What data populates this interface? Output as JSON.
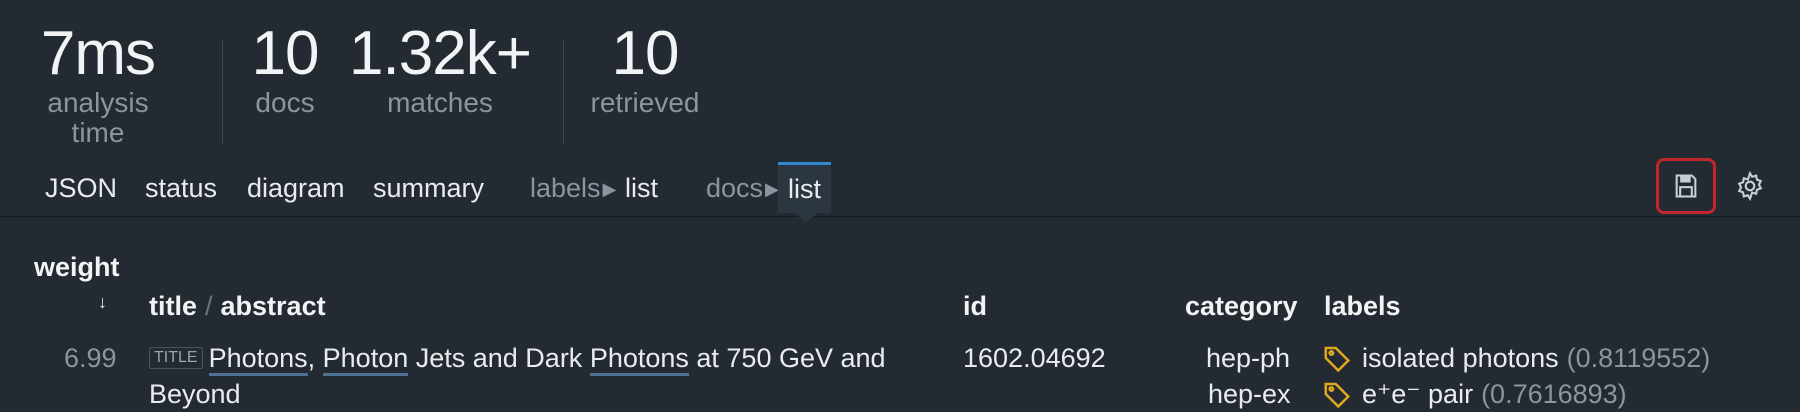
{
  "stats": [
    {
      "value": "7ms",
      "label": "analysis time"
    },
    {
      "value": "10",
      "label": "docs"
    },
    {
      "value": "1.32k+",
      "label": "matches"
    },
    {
      "value": "10",
      "label": "retrieved"
    }
  ],
  "tabs": {
    "json": "JSON",
    "status": "status",
    "diagram": "diagram",
    "summary": "summary",
    "labels_group": "labels",
    "labels_list": "list",
    "docs_group": "docs",
    "docs_list": "list"
  },
  "toolbar": {
    "save_icon": "save-icon",
    "settings_icon": "gear-icon"
  },
  "table": {
    "headers": {
      "weight": "weight",
      "title": "title",
      "abstract": "abstract",
      "id": "id",
      "category": "category",
      "labels": "labels"
    },
    "rows": [
      {
        "weight": "6.99",
        "title_tag": "TITLE",
        "title_parts": [
          "Photons",
          ", ",
          "Photon",
          " Jets and Dark ",
          "Photons",
          " at 750 GeV and"
        ],
        "title_line2": "Beyond",
        "id": "1602.04692",
        "categories": [
          "hep-ph",
          "hep-ex"
        ],
        "labels": [
          {
            "name": "isolated photons",
            "score": "(0.8119552)"
          },
          {
            "name": "e⁺e⁻ pair",
            "score": "(0.7616893)"
          }
        ]
      }
    ]
  },
  "colors": {
    "accent": "#2f8ad0",
    "label_icon": "#e0a81e",
    "focus_ring": "#c2262d",
    "highlight_underline": "#4f6f93"
  }
}
